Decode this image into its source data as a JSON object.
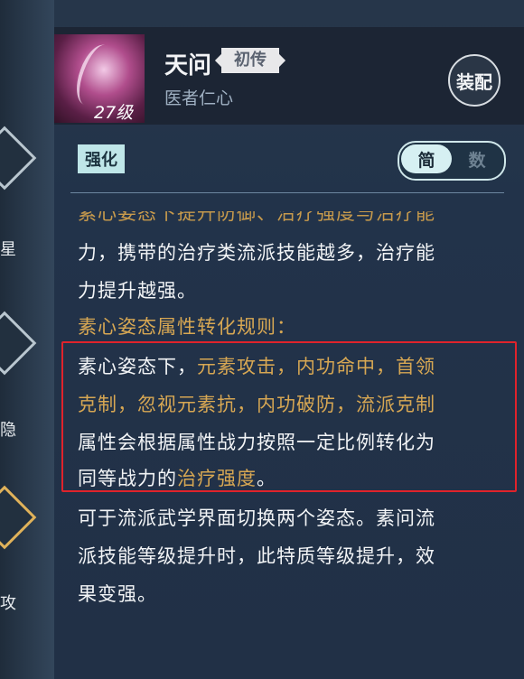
{
  "left_nav": {
    "items": [
      "星",
      "隐",
      "攻"
    ]
  },
  "header": {
    "level": "27级",
    "name": "天问",
    "rank": "初传",
    "subtitle": "医者仁心",
    "equip_label": "装配"
  },
  "controls": {
    "enhance_label": "强化",
    "toggle_simple": "简",
    "toggle_numeric": "数"
  },
  "description": {
    "line0": "素心姿态下提升防御、治疗强度与治疗能",
    "line1": "力，携带的治疗类流派技能越多，治疗能",
    "line2": "力提升越强。",
    "rules_heading": "素心姿态属性转化规则：",
    "line4a": "素心姿态下，",
    "line4b": "元素攻击，内功命中，首领",
    "line5": "克制，忽视元素抗，内功破防，流派克制",
    "line6": "属性会根据属性战力按照一定比例转化为",
    "line7a": "同等战力的",
    "line7b": "治疗强度",
    "line7c": "。",
    "line8": "可于流派武学界面切换两个姿态。素问流",
    "line9": "派技能等级提升时，此特质等级提升，效",
    "line10": "果变强。"
  },
  "colors": {
    "accent_gold": "#d7a753",
    "highlight_red": "#e0232b"
  }
}
